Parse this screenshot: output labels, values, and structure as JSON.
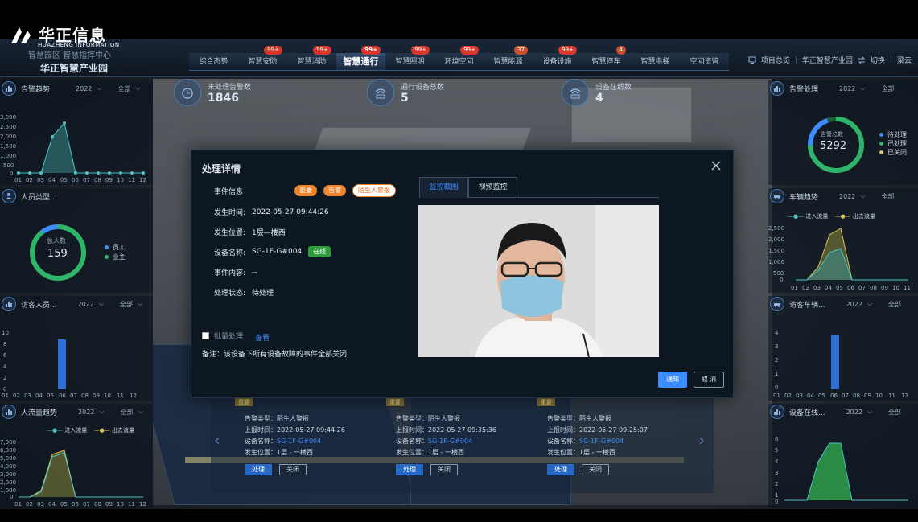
{
  "brand": {
    "name": "华正信息",
    "sub": "HUAZHENG INFORMATION",
    "system": "智慧园区 智慧指挥中心",
    "park": "华正智慧产业园"
  },
  "nav": [
    {
      "label": "综合态势",
      "badge": ""
    },
    {
      "label": "智慧安防",
      "badge": "99+"
    },
    {
      "label": "智慧消防",
      "badge": "99+"
    },
    {
      "label": "智慧通行",
      "badge": "99+",
      "active": true
    },
    {
      "label": "智慧照明",
      "badge": "99+"
    },
    {
      "label": "环境空间",
      "badge": "99+"
    },
    {
      "label": "智慧能源",
      "badge": "37"
    },
    {
      "label": "设备设施",
      "badge": "99+"
    },
    {
      "label": "智慧停车",
      "badge": "4"
    },
    {
      "label": "智慧电梯",
      "badge": ""
    },
    {
      "label": "空间资管",
      "badge": ""
    }
  ],
  "topright": {
    "overview": "项目总览",
    "park": "华正智慧产业园",
    "switch": "切换",
    "user": "梁云"
  },
  "stats": [
    {
      "label": "未处理告警数",
      "value": "1846"
    },
    {
      "label": "通行设备总数",
      "value": "5"
    },
    {
      "label": "设备在线数",
      "value": "4"
    }
  ],
  "left": {
    "alarm_trend": {
      "title": "告警趋势",
      "year": "2022",
      "scope": "全部",
      "yticks": [
        "3,000",
        "2,500",
        "2,000",
        "1,500",
        "1,000",
        "500",
        "0"
      ],
      "xticks": [
        "01",
        "02",
        "03",
        "04",
        "05",
        "06",
        "07",
        "08",
        "09",
        "10",
        "11",
        "12"
      ]
    },
    "person_type": {
      "title": "人员类型...",
      "total_label": "总人数",
      "total": "159",
      "legend": [
        "员工",
        "业主"
      ]
    },
    "visitors": {
      "title": "访客人员...",
      "year": "2022",
      "scope": "全部",
      "yticks": [
        "10",
        "8",
        "6",
        "4",
        "2",
        "0"
      ],
      "xticks": [
        "01",
        "02",
        "03",
        "04",
        "05",
        "06",
        "07",
        "08",
        "09",
        "10",
        "11",
        "12"
      ]
    },
    "flow": {
      "title": "人流量趋势",
      "year": "2022",
      "scope": "全部",
      "legend_in": "进入流量",
      "legend_out": "出去流量",
      "yticks": [
        "7,000",
        "6,000",
        "5,000",
        "4,000",
        "3,000",
        "2,000",
        "1,000",
        "0"
      ],
      "xticks": [
        "01",
        "02",
        "03",
        "04",
        "05",
        "06",
        "07",
        "08",
        "09",
        "10",
        "11",
        "12"
      ]
    }
  },
  "right": {
    "alarm_handle": {
      "title": "告警处理",
      "year": "2022",
      "scope": "全部",
      "center_label": "告警总数",
      "center_value": "5292",
      "legend": [
        "待处理",
        "已处理",
        "已关闭"
      ]
    },
    "vehicle_trend": {
      "title": "车辆趋势",
      "year": "2022",
      "scope": "全部",
      "legend_in": "进入流量",
      "legend_out": "出去流量",
      "yticks": [
        "2,500",
        "2,000",
        "1,500",
        "1,000",
        "500",
        "0"
      ],
      "xticks": [
        "01",
        "02",
        "03",
        "04",
        "05",
        "06",
        "07",
        "08",
        "09",
        "10",
        "11",
        "12"
      ]
    },
    "visitor_vehicle": {
      "title": "访客车辆...",
      "year": "2022",
      "scope": "全部",
      "yticks": [
        "4",
        "3",
        "2",
        "1",
        "0"
      ],
      "xticks": [
        "01",
        "02",
        "03",
        "04",
        "05",
        "06",
        "07",
        "08",
        "09",
        "10",
        "11",
        "12"
      ]
    },
    "device_online": {
      "title": "设备在线...",
      "year": "2022",
      "scope": "全部",
      "yticks": [
        "6",
        "5",
        "4",
        "3",
        "2",
        "1",
        "0"
      ],
      "xticks": [
        "01",
        "02",
        "03",
        "04",
        "05",
        "06",
        "07",
        "08",
        "09",
        "10",
        "11",
        "12"
      ]
    }
  },
  "modal": {
    "title": "处理详情",
    "event_info_label": "事件信息",
    "tags": [
      "重要",
      "告警",
      "陌生人警报"
    ],
    "time_label": "发生时间:",
    "time": "2022-05-27 09:44:26",
    "location_label": "发生位置:",
    "location": "1层—楼西",
    "device_label": "设备名称:",
    "device": "SG-1F-G#004",
    "device_status": "在线",
    "content_label": "事件内容:",
    "content": "--",
    "state_label": "处理状态:",
    "state": "待处理",
    "batch_label": "批量处理",
    "view_link": "查看",
    "note": "备注：该设备下所有设备故障的事件全部关闭",
    "tab_snapshot": "监控截图",
    "tab_video": "视频监控",
    "ok": "通知",
    "cancel": "取 消"
  },
  "alarm_cards": [
    {
      "tag": "重要",
      "type_label": "告警类型：",
      "type": "陌生人警报",
      "report_label": "上报时间：",
      "report": "2022-05-27 09:44:26",
      "device_label": "设备名称：",
      "device": "SG-1F-G#004",
      "loc_label": "发生位置：",
      "loc": "1层 - 一楼西",
      "btn_handle": "处理",
      "btn_close": "关闭"
    },
    {
      "tag": "重要",
      "type_label": "告警类型：",
      "type": "陌生人警报",
      "report_label": "上报时间：",
      "report": "2022-05-27 09:35:36",
      "device_label": "设备名称：",
      "device": "SG-1F-G#004",
      "loc_label": "发生位置：",
      "loc": "1层 - 一楼西",
      "btn_handle": "处理",
      "btn_close": "关闭"
    },
    {
      "tag": "重要",
      "type_label": "告警类型：",
      "type": "陌生人警报",
      "report_label": "上报时间：",
      "report": "2022-05-27 09:25:07",
      "device_label": "设备名称：",
      "device": "SG-1F-G#004",
      "loc_label": "发生位置：",
      "loc": "1层 - 一楼西",
      "btn_handle": "处理",
      "btn_close": "关闭"
    }
  ],
  "colors": {
    "accent": "#3c8cff",
    "badge": "#d8362b",
    "tag_orange": "#f0842a",
    "online": "#2e9e3a",
    "chart_teal": "#4cc4c4",
    "chart_gold": "#d6c35a"
  }
}
